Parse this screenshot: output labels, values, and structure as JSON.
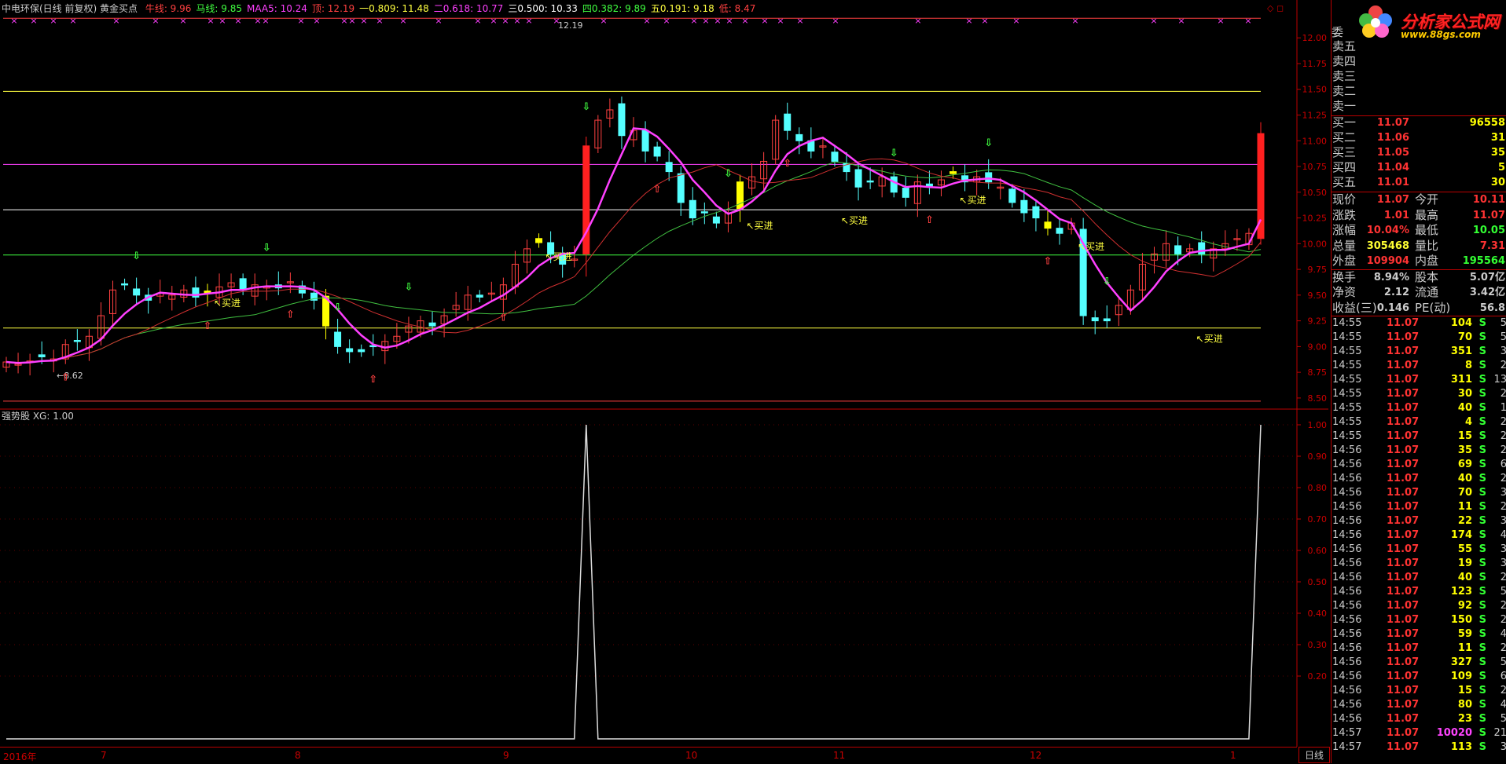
{
  "header": {
    "title": "中电环保(日线 前复权) 黄金买点",
    "items": [
      {
        "label": "牛线: 9.96",
        "color": "#ff4040"
      },
      {
        "label": "马线: 9.85",
        "color": "#40ff40"
      },
      {
        "label": "MAA5: 10.24",
        "color": "#ff40ff"
      },
      {
        "label": "顶: 12.19",
        "color": "#ff4040"
      },
      {
        "label": "一0.809: 11.48",
        "color": "#ffff40"
      },
      {
        "label": "二0.618: 10.77",
        "color": "#ff40ff"
      },
      {
        "label": "三0.500: 10.33",
        "color": "#ffffff"
      },
      {
        "label": "四0.382: 9.89",
        "color": "#40ff40"
      },
      {
        "label": "五0.191: 9.18",
        "color": "#ffff40"
      },
      {
        "label": "低: 8.47",
        "color": "#ff4040"
      }
    ]
  },
  "sub_header": "强势股 XG: 1.00",
  "price_axis": [
    "12.00",
    "11.75",
    "11.50",
    "11.25",
    "11.00",
    "10.75",
    "10.50",
    "10.25",
    "10.00",
    "9.75",
    "9.50",
    "9.25",
    "9.00",
    "8.75",
    "8.50"
  ],
  "sub_axis": [
    "1.00",
    "0.90",
    "0.80",
    "0.70",
    "0.60",
    "0.50",
    "0.40",
    "0.30",
    "0.20"
  ],
  "annotations": {
    "high": "12.19",
    "low": "8.62",
    "buy": "买进"
  },
  "date_axis": [
    "2016年",
    "7",
    "8",
    "9",
    "10",
    "11",
    "12",
    "1"
  ],
  "period_button": "日线",
  "logo": {
    "name": "分析家公式网",
    "url": "www.88gs.com"
  },
  "quote": {
    "wei_label": "委",
    "sell": [
      {
        "label": "卖五"
      },
      {
        "label": "卖四"
      },
      {
        "label": "卖三"
      },
      {
        "label": "卖二"
      },
      {
        "label": "卖一"
      }
    ],
    "buy": [
      {
        "label": "买一",
        "price": "11.07",
        "vol": "96558"
      },
      {
        "label": "买二",
        "price": "11.06",
        "vol": "31"
      },
      {
        "label": "买三",
        "price": "11.05",
        "vol": "35"
      },
      {
        "label": "买四",
        "price": "11.04",
        "vol": "5"
      },
      {
        "label": "买五",
        "price": "11.01",
        "vol": "30"
      }
    ],
    "stats": [
      {
        "k1": "现价",
        "v1": "11.07",
        "c1": "#ff3333",
        "k2": "今开",
        "v2": "10.11",
        "c2": "#ff3333"
      },
      {
        "k1": "涨跌",
        "v1": "1.01",
        "c1": "#ff3333",
        "k2": "最高",
        "v2": "11.07",
        "c2": "#ff3333"
      },
      {
        "k1": "涨幅",
        "v1": "10.04%",
        "c1": "#ff3333",
        "k2": "最低",
        "v2": "10.05",
        "c2": "#33ff33"
      },
      {
        "k1": "总量",
        "v1": "305468",
        "c1": "#ffff33",
        "k2": "量比",
        "v2": "7.31",
        "c2": "#ff3333"
      },
      {
        "k1": "外盘",
        "v1": "109904",
        "c1": "#ff3333",
        "k2": "内盘",
        "v2": "195564",
        "c2": "#33ff33"
      },
      {
        "k1": "换手",
        "v1": "8.94%",
        "c1": "#cccccc",
        "k2": "股本",
        "v2": "5.07亿",
        "c2": "#cccccc"
      },
      {
        "k1": "净资",
        "v1": "2.12",
        "c1": "#cccccc",
        "k2": "流通",
        "v2": "3.42亿",
        "c2": "#cccccc"
      },
      {
        "k1": "收益(三)",
        "v1": "0.146",
        "c1": "#cccccc",
        "k2": "PE(动)",
        "v2": "56.8",
        "c2": "#cccccc"
      }
    ],
    "ticks": [
      {
        "t": "14:55",
        "p": "11.07",
        "v": "104",
        "s": "S",
        "n": "5"
      },
      {
        "t": "14:55",
        "p": "11.07",
        "v": "70",
        "s": "S",
        "n": "5"
      },
      {
        "t": "14:55",
        "p": "11.07",
        "v": "351",
        "s": "S",
        "n": "3"
      },
      {
        "t": "14:55",
        "p": "11.07",
        "v": "8",
        "s": "S",
        "n": "2"
      },
      {
        "t": "14:55",
        "p": "11.07",
        "v": "311",
        "s": "S",
        "n": "13"
      },
      {
        "t": "14:55",
        "p": "11.07",
        "v": "30",
        "s": "S",
        "n": "2"
      },
      {
        "t": "14:55",
        "p": "11.07",
        "v": "40",
        "s": "S",
        "n": "1"
      },
      {
        "t": "14:55",
        "p": "11.07",
        "v": "4",
        "s": "S",
        "n": "2"
      },
      {
        "t": "14:55",
        "p": "11.07",
        "v": "15",
        "s": "S",
        "n": "2"
      },
      {
        "t": "14:56",
        "p": "11.07",
        "v": "35",
        "s": "S",
        "n": "2"
      },
      {
        "t": "14:56",
        "p": "11.07",
        "v": "69",
        "s": "S",
        "n": "6"
      },
      {
        "t": "14:56",
        "p": "11.07",
        "v": "40",
        "s": "S",
        "n": "2"
      },
      {
        "t": "14:56",
        "p": "11.07",
        "v": "70",
        "s": "S",
        "n": "3"
      },
      {
        "t": "14:56",
        "p": "11.07",
        "v": "11",
        "s": "S",
        "n": "2"
      },
      {
        "t": "14:56",
        "p": "11.07",
        "v": "22",
        "s": "S",
        "n": "3"
      },
      {
        "t": "14:56",
        "p": "11.07",
        "v": "174",
        "s": "S",
        "n": "4"
      },
      {
        "t": "14:56",
        "p": "11.07",
        "v": "55",
        "s": "S",
        "n": "3"
      },
      {
        "t": "14:56",
        "p": "11.07",
        "v": "19",
        "s": "S",
        "n": "3"
      },
      {
        "t": "14:56",
        "p": "11.07",
        "v": "40",
        "s": "S",
        "n": "2"
      },
      {
        "t": "14:56",
        "p": "11.07",
        "v": "123",
        "s": "S",
        "n": "5"
      },
      {
        "t": "14:56",
        "p": "11.07",
        "v": "92",
        "s": "S",
        "n": "2"
      },
      {
        "t": "14:56",
        "p": "11.07",
        "v": "150",
        "s": "S",
        "n": "2"
      },
      {
        "t": "14:56",
        "p": "11.07",
        "v": "59",
        "s": "S",
        "n": "4"
      },
      {
        "t": "14:56",
        "p": "11.07",
        "v": "11",
        "s": "S",
        "n": "2"
      },
      {
        "t": "14:56",
        "p": "11.07",
        "v": "327",
        "s": "S",
        "n": "5"
      },
      {
        "t": "14:56",
        "p": "11.07",
        "v": "109",
        "s": "S",
        "n": "6"
      },
      {
        "t": "14:56",
        "p": "11.07",
        "v": "15",
        "s": "S",
        "n": "2"
      },
      {
        "t": "14:56",
        "p": "11.07",
        "v": "80",
        "s": "S",
        "n": "4"
      },
      {
        "t": "14:56",
        "p": "11.07",
        "v": "23",
        "s": "S",
        "n": "5"
      },
      {
        "t": "14:57",
        "p": "11.07",
        "v": "10020",
        "s": "S",
        "n": "21"
      },
      {
        "t": "14:57",
        "p": "11.07",
        "v": "113",
        "s": "S",
        "n": "3"
      }
    ]
  },
  "chart_data": {
    "type": "candlestick",
    "ylim": [
      8.4,
      12.2
    ],
    "levels": [
      {
        "name": "顶",
        "value": 12.19,
        "color": "#ff4040"
      },
      {
        "name": "一0.809",
        "value": 11.48,
        "color": "#ffff40"
      },
      {
        "name": "二0.618",
        "value": 10.77,
        "color": "#ff40ff"
      },
      {
        "name": "三0.500",
        "value": 10.33,
        "color": "#ffffff"
      },
      {
        "name": "四0.382",
        "value": 9.89,
        "color": "#40ff40"
      },
      {
        "name": "五0.191",
        "value": 9.18,
        "color": "#ffff40"
      },
      {
        "name": "低",
        "value": 8.47,
        "color": "#ff4040"
      }
    ],
    "closes": [
      8.85,
      8.83,
      8.86,
      8.9,
      8.88,
      9.02,
      9.05,
      9.1,
      9.3,
      9.55,
      9.6,
      9.5,
      9.45,
      9.52,
      9.5,
      9.55,
      9.48,
      9.52,
      9.58,
      9.62,
      9.55,
      9.6,
      9.58,
      9.57,
      9.63,
      9.52,
      9.45,
      9.2,
      9.0,
      8.95,
      8.95,
      9.0,
      9.05,
      9.1,
      9.2,
      9.25,
      9.2,
      9.3,
      9.4,
      9.5,
      9.48,
      9.52,
      9.6,
      9.8,
      9.95,
      10.05,
      9.9,
      9.8,
      9.85,
      10.95,
      11.2,
      11.3,
      11.05,
      11.1,
      10.9,
      10.85,
      10.7,
      10.4,
      10.25,
      10.3,
      10.2,
      10.3,
      10.6,
      10.65,
      10.8,
      11.2,
      11.1,
      11.0,
      10.9,
      10.95,
      10.8,
      10.7,
      10.55,
      10.6,
      10.65,
      10.5,
      10.45,
      10.6,
      10.55,
      10.62,
      10.7,
      10.6,
      10.65,
      10.6,
      10.55,
      10.4,
      10.3,
      10.25,
      10.15,
      10.1,
      10.2,
      9.3,
      9.25,
      9.25,
      9.4,
      9.55,
      9.8,
      9.9,
      10.0,
      9.9,
      9.95,
      9.9,
      9.95,
      10.0,
      10.05,
      10.1,
      11.07
    ],
    "ma_ox": 9.96,
    "ma_horse": 9.85,
    "maa5": 10.24,
    "sub_signal": [
      0,
      0,
      0,
      0,
      0,
      0,
      0,
      0,
      0,
      0,
      0,
      0,
      0,
      0,
      0,
      0,
      0,
      0,
      0,
      0,
      0,
      0,
      0,
      0,
      0,
      0,
      0,
      0,
      0,
      0,
      0,
      0,
      0,
      0,
      0,
      0,
      0,
      0,
      0,
      0,
      0,
      0,
      0,
      0,
      0,
      0,
      0,
      0,
      0,
      1,
      0,
      0,
      0,
      0,
      0,
      0,
      0,
      0,
      0,
      0,
      0,
      0,
      0,
      0,
      0,
      0,
      0,
      0,
      0,
      0,
      0,
      0,
      0,
      0,
      0,
      0,
      0,
      0,
      0,
      0,
      0,
      0,
      0,
      0,
      0,
      0,
      0,
      0,
      0,
      0,
      0,
      0,
      0,
      0,
      0,
      0,
      0,
      0,
      0,
      0,
      0,
      0,
      0,
      0,
      0,
      0,
      1
    ]
  }
}
